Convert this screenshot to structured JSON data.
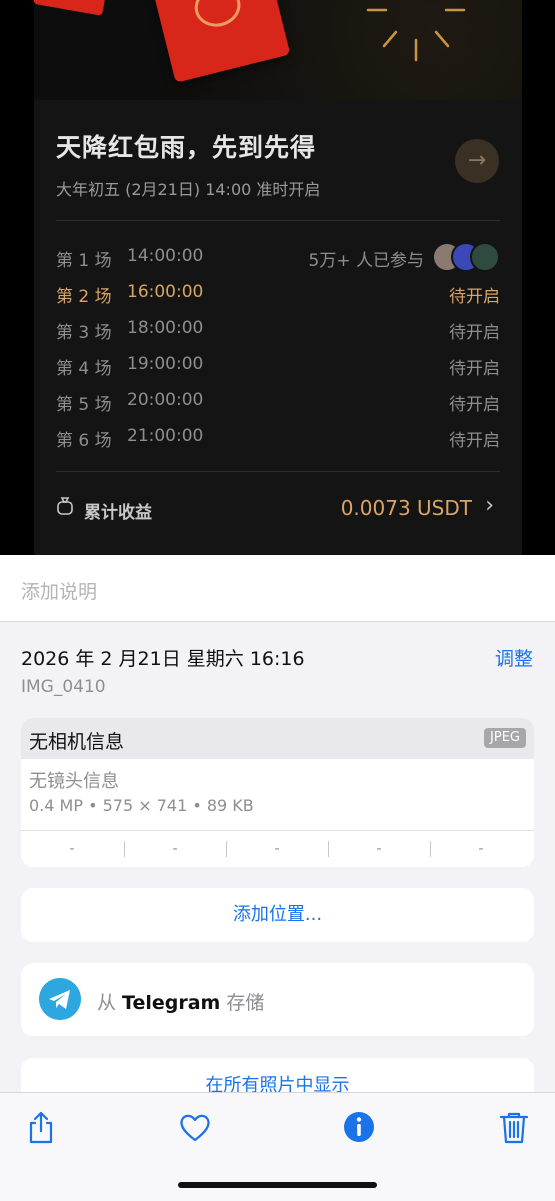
{
  "photo": {
    "card": {
      "title": "天降红包雨，先到先得",
      "subtitle": "大年初五 (2月21日) 14:00 准时开启",
      "rounds": [
        {
          "label": "第 1 场",
          "time": "14:00:00",
          "status": "5万+ 人已参与",
          "active": false
        },
        {
          "label": "第 2 场",
          "time": "16:00:00",
          "status": "待开启",
          "active": true
        },
        {
          "label": "第 3 场",
          "time": "18:00:00",
          "status": "待开启",
          "active": false
        },
        {
          "label": "第 4 场",
          "time": "19:00:00",
          "status": "待开启",
          "active": false
        },
        {
          "label": "第 5 场",
          "time": "20:00:00",
          "status": "待开启",
          "active": false
        },
        {
          "label": "第 6 场",
          "time": "21:00:00",
          "status": "待开启",
          "active": false
        }
      ],
      "earnings_label": "累计收益",
      "earnings_value": "0.0073 USDT",
      "accent_color": "#d9a464"
    }
  },
  "caption": {
    "placeholder": "添加说明"
  },
  "meta": {
    "datetime": "2026 年 2 月21日 星期六 16:16",
    "adjust_label": "调整",
    "filename": "IMG_0410"
  },
  "info": {
    "camera": "无相机信息",
    "format_badge": "JPEG",
    "lens": "无镜头信息",
    "specs": "0.4 MP • 575 × 741 • 89 KB",
    "exif": [
      "-",
      "-",
      "-",
      "-",
      "-"
    ]
  },
  "actions": {
    "add_location": "添加位置...",
    "source_prefix": "从 ",
    "source_app": "Telegram",
    "source_suffix": " 存储",
    "show_in_all": "在所有照片中显示"
  },
  "toolbar": {
    "items": [
      "share-icon",
      "heart-icon",
      "info-icon",
      "trash-icon"
    ],
    "accent_color": "#1a73e8"
  }
}
